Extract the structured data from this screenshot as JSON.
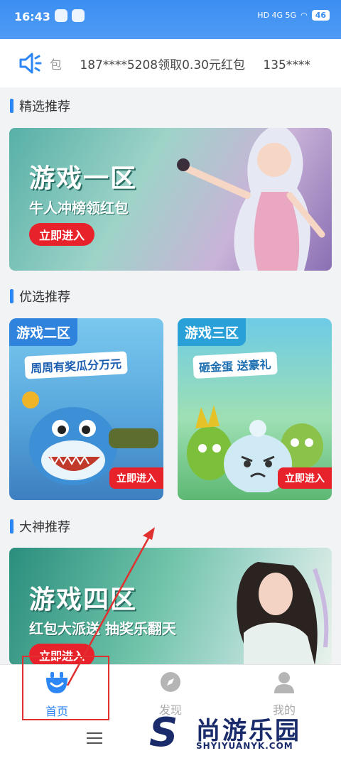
{
  "status_bar": {
    "time": "16:43",
    "network": "HD 4G 5G",
    "battery": "46"
  },
  "notice": {
    "messages": [
      "包",
      "187****5208领取0.30元红包",
      "135****"
    ]
  },
  "sections": {
    "featured": "精选推荐",
    "preferred": "优选推荐",
    "master": "大神推荐"
  },
  "banner1": {
    "title": "游戏一区",
    "subtitle": "牛人冲榜领红包",
    "button": "立即进入"
  },
  "card2": {
    "tag": "游戏二区",
    "slogan": "周周有奖瓜分万元",
    "button": "立即进入"
  },
  "card3": {
    "tag": "游戏三区",
    "slogan": "砸金蛋 送豪礼",
    "button": "立即进入"
  },
  "banner4": {
    "title": "游戏四区",
    "subtitle": "红包大派送  抽奖乐翻天",
    "button": "立即进入"
  },
  "tabbar": {
    "home": "首页",
    "discover": "发现",
    "mine": "我的"
  },
  "watermark": {
    "logo": "S",
    "cn": "尚游乐园",
    "en": "SHYIYUANYK.COM"
  }
}
